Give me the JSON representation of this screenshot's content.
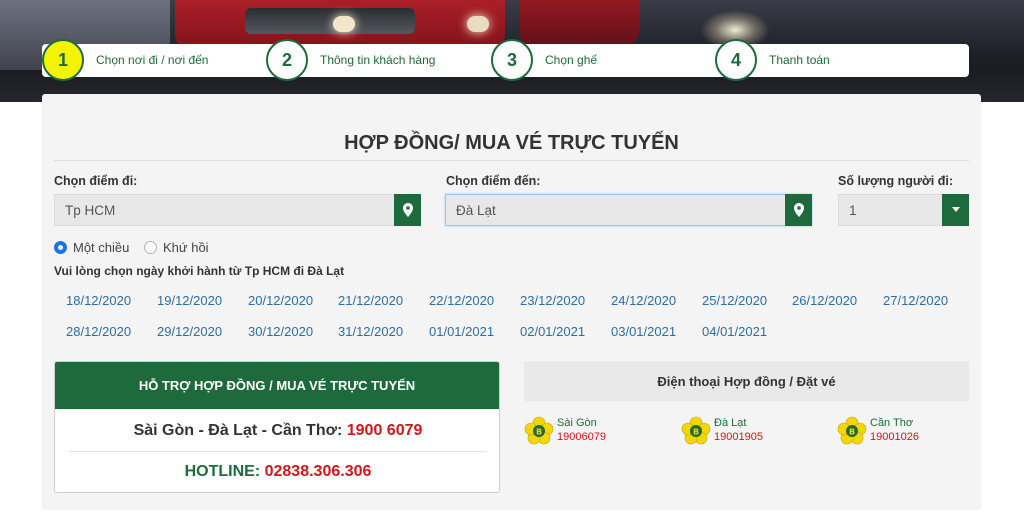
{
  "steps": [
    {
      "num": "1",
      "label": "Chọn nơi đi / nơi đến"
    },
    {
      "num": "2",
      "label": "Thông tin khách hàng"
    },
    {
      "num": "3",
      "label": "Chọn ghế"
    },
    {
      "num": "4",
      "label": "Thanh toán"
    }
  ],
  "form": {
    "title": "HỢP ĐỒNG/ MUA VÉ TRỰC TUYẾN",
    "origin_label": "Chọn điểm đi:",
    "origin_value": "Tp HCM",
    "dest_label": "Chọn điểm đến:",
    "dest_value": "Đà Lạt",
    "qty_label": "Số lượng người đi:",
    "qty_value": "1",
    "trip_one_way": "Một chiều",
    "trip_round": "Khứ hồi",
    "hint": "Vui lòng chọn ngày khởi hành từ Tp HCM đi Đà Lạt"
  },
  "dates": [
    "18/12/2020",
    "19/12/2020",
    "20/12/2020",
    "21/12/2020",
    "22/12/2020",
    "23/12/2020",
    "24/12/2020",
    "25/12/2020",
    "26/12/2020",
    "27/12/2020",
    "28/12/2020",
    "29/12/2020",
    "30/12/2020",
    "31/12/2020",
    "01/01/2021",
    "02/01/2021",
    "03/01/2021",
    "04/01/2021"
  ],
  "support": {
    "header": "HỖ TRỢ HỢP ĐỒNG / MUA VÉ TRỰC TUYẾN",
    "route_text": "Sài Gòn - Đà Lạt - Cần Thơ: ",
    "route_phone": "1900 6079",
    "hotline_label": "HOTLINE: ",
    "hotline_phone": "02838.306.306"
  },
  "phones": {
    "header": "Điện thoại Hợp đồng / Đặt vé",
    "offices": [
      {
        "name": "Sài Gòn",
        "phone": "19006079"
      },
      {
        "name": "Đà Lạt",
        "phone": "19001905"
      },
      {
        "name": "Cần Thơ",
        "phone": "19001026"
      }
    ]
  },
  "colors": {
    "brand_green": "#1e6a3c",
    "accent_red": "#d8141b",
    "link_blue": "#2e6da4",
    "active_step": "#f4f400"
  }
}
